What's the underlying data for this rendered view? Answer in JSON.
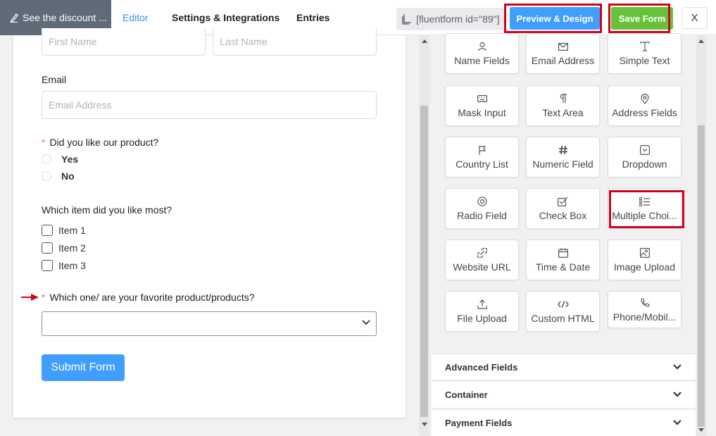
{
  "header": {
    "discount_label": "See the discount ...",
    "tabs": [
      {
        "label": "Editor",
        "active": true
      },
      {
        "label": "Settings & Integrations",
        "active": false
      },
      {
        "label": "Entries",
        "active": false
      }
    ],
    "shortcode": "[fluentform id=\"89\"]",
    "preview_label": "Preview & Design",
    "save_label": "Save Form",
    "close_label": "X"
  },
  "form": {
    "first_name_placeholder": "First Name",
    "last_name_placeholder": "Last Name",
    "email_label": "Email",
    "email_placeholder": "Email Address",
    "q1_label": "Did you like our product?",
    "q1_options": [
      "Yes",
      "No"
    ],
    "q2_label": "Which item did you like most?",
    "q2_options": [
      "Item 1",
      "Item 2",
      "Item 3"
    ],
    "q3_label": "Which one/ are your favorite product/products?",
    "q3_value": "",
    "submit_label": "Submit Form"
  },
  "fields_panel": {
    "cards": [
      {
        "label": "Name Fields",
        "icon": "user-icon"
      },
      {
        "label": "Email Address",
        "icon": "envelope-icon"
      },
      {
        "label": "Simple Text",
        "icon": "text-cursor-icon"
      },
      {
        "label": "Mask Input",
        "icon": "keyboard-icon"
      },
      {
        "label": "Text Area",
        "icon": "paragraph-icon"
      },
      {
        "label": "Address Fields",
        "icon": "map-pin-icon"
      },
      {
        "label": "Country List",
        "icon": "flag-icon"
      },
      {
        "label": "Numeric Field",
        "icon": "hash-icon"
      },
      {
        "label": "Dropdown",
        "icon": "dropdown-icon"
      },
      {
        "label": "Radio Field",
        "icon": "radio-icon"
      },
      {
        "label": "Check Box",
        "icon": "checkbox-icon"
      },
      {
        "label": "Multiple Choi...",
        "icon": "list-icon"
      },
      {
        "label": "Website URL",
        "icon": "link-icon"
      },
      {
        "label": "Time & Date",
        "icon": "calendar-icon"
      },
      {
        "label": "Image Upload",
        "icon": "image-icon"
      },
      {
        "label": "File Upload",
        "icon": "upload-icon"
      },
      {
        "label": "Custom HTML",
        "icon": "code-icon"
      },
      {
        "label": "Phone/Mobil...",
        "icon": "phone-icon"
      }
    ],
    "sections": [
      "Advanced Fields",
      "Container",
      "Payment Fields"
    ]
  },
  "colors": {
    "primary": "#409eff",
    "save": "#67c23a",
    "highlight": "#d0021b",
    "discount_bg": "#5f6b79"
  }
}
